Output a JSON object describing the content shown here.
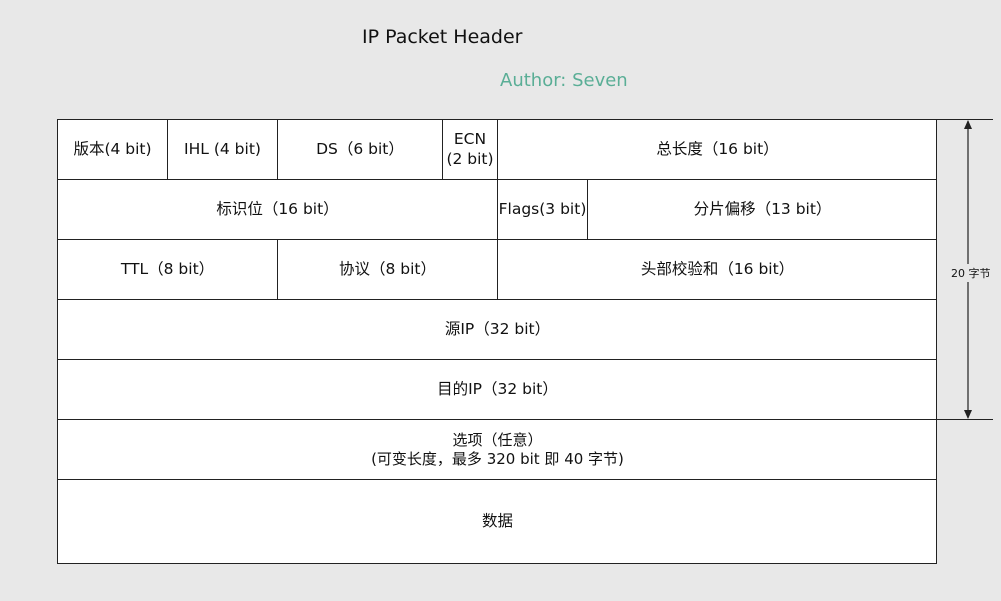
{
  "title": "IP Packet Header",
  "author": "Author: Seven",
  "rows": [
    [
      "版本(4 bit)",
      "IHL (4 bit)",
      "DS（6 bit）",
      "ECN\n(2 bit)",
      "总长度（16 bit）"
    ],
    [
      "标识位（16 bit）",
      "Flags(3 bit)",
      "分片偏移（13 bit）"
    ],
    [
      "TTL（8 bit）",
      "协议（8 bit）",
      "头部校验和（16 bit）"
    ],
    [
      "源IP（32 bit）"
    ],
    [
      "目的IP（32 bit）"
    ],
    [
      "选项（任意）\n(可变长度，最多 320 bit 即 40 字节)"
    ],
    [
      "数据"
    ]
  ],
  "size_label": "20 字节"
}
